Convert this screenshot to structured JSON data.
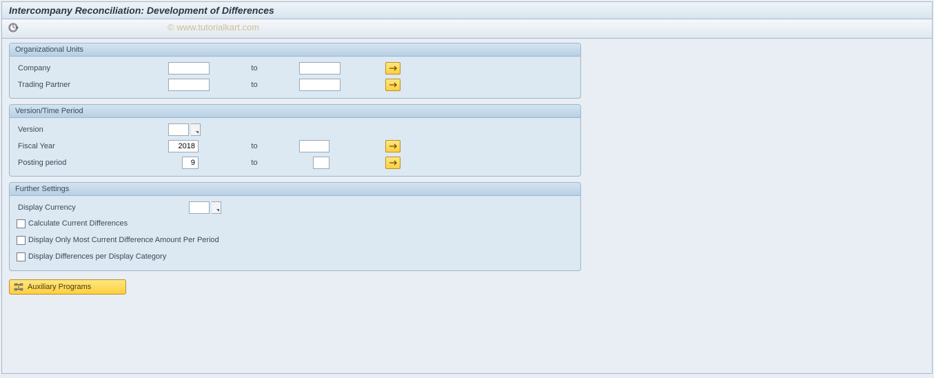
{
  "title": "Intercompany Reconciliation: Development of Differences",
  "watermark": "© www.tutorialkart.com",
  "org_units": {
    "title": "Organizational Units",
    "company_label": "Company",
    "company_from": "",
    "company_to_label": "to",
    "company_to": "",
    "partner_label": "Trading Partner",
    "partner_from": "",
    "partner_to_label": "to",
    "partner_to": ""
  },
  "version_period": {
    "title": "Version/Time Period",
    "version_label": "Version",
    "version_value": "",
    "fiscal_year_label": "Fiscal Year",
    "fiscal_year_from": "2018",
    "fiscal_year_to_label": "to",
    "fiscal_year_to": "",
    "posting_period_label": "Posting period",
    "posting_period_from": "9",
    "posting_period_to_label": "to",
    "posting_period_to": ""
  },
  "further_settings": {
    "title": "Further Settings",
    "display_currency_label": "Display Currency",
    "display_currency_value": "",
    "calc_current_diff_label": "Calculate Current Differences",
    "calc_current_diff_checked": false,
    "most_current_label": "Display Only Most Current Difference Amount Per Period",
    "most_current_checked": false,
    "per_category_label": "Display Differences per Display Category",
    "per_category_checked": false
  },
  "aux_button_label": "Auxiliary Programs"
}
